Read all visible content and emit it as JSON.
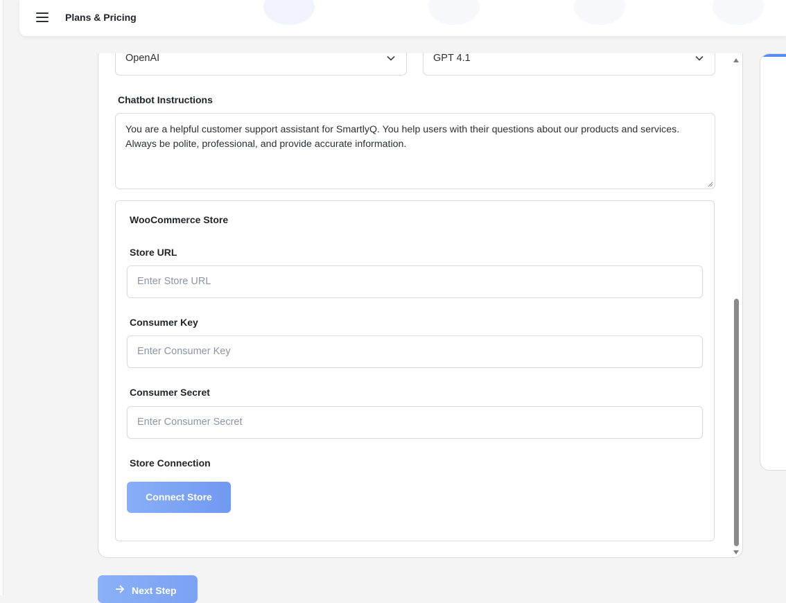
{
  "header": {
    "title": "Plans & Pricing",
    "menu_icon": "hamburger-menu-icon"
  },
  "model": {
    "provider": "OpenAI",
    "model": "GPT 4.1"
  },
  "instructions": {
    "label": "Chatbot Instructions",
    "value": "You are a helpful customer support assistant for SmartlyQ. You help users with their questions about our products and services. Always be polite, professional, and provide accurate information."
  },
  "woocommerce": {
    "section_title": "WooCommerce Store",
    "store_url": {
      "label": "Store URL",
      "placeholder": "Enter Store URL"
    },
    "consumer_key": {
      "label": "Consumer Key",
      "placeholder": "Enter Consumer Key"
    },
    "consumer_secret": {
      "label": "Consumer Secret",
      "placeholder": "Enter Consumer Secret"
    },
    "connection_label": "Store Connection",
    "connect_button": "Connect Store"
  },
  "footer": {
    "next_button": "Next Step",
    "next_icon": "arrow-right-icon"
  },
  "colors": {
    "accent": "#7199f1",
    "background": "#f4f4f5",
    "border": "#d9dadd"
  }
}
